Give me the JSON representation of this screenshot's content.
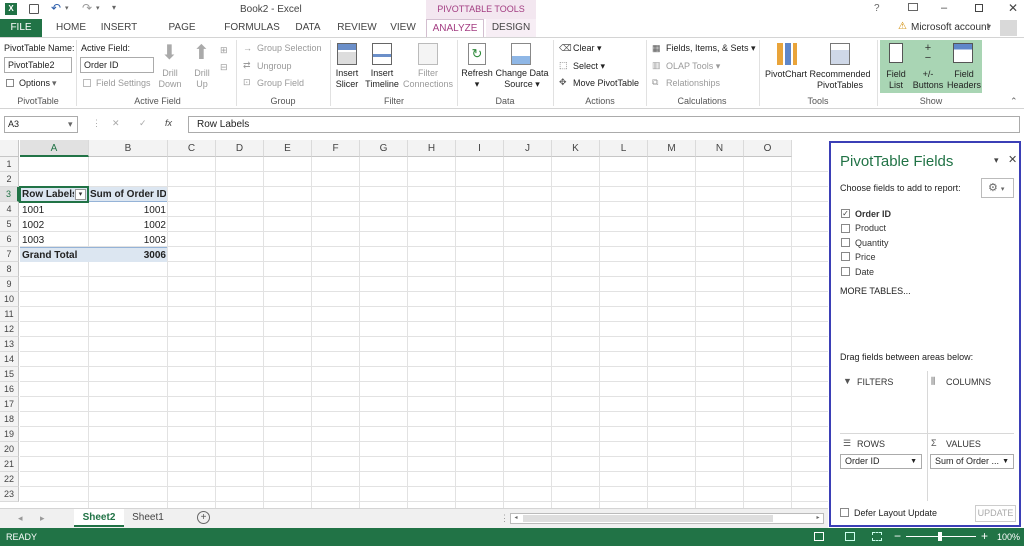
{
  "window": {
    "title": "Book2 - Excel",
    "context_group": "PIVOTTABLE TOOLS",
    "account": "Microsoft account"
  },
  "tabs": {
    "file": "FILE",
    "home": "HOME",
    "insert": "INSERT",
    "page_layout": "PAGE LAYOUT",
    "formulas": "FORMULAS",
    "data": "DATA",
    "review": "REVIEW",
    "view": "VIEW",
    "analyze": "ANALYZE",
    "design": "DESIGN"
  },
  "ribbon": {
    "pivottable": {
      "name_label": "PivotTable Name:",
      "name_value": "PivotTable2",
      "options": "Options",
      "group": "PivotTable"
    },
    "active_field": {
      "label": "Active Field:",
      "value": "Order ID",
      "field_settings": "Field Settings",
      "drill_down_1": "Drill",
      "drill_down_2": "Down",
      "drill_up_1": "Drill",
      "drill_up_2": "Up",
      "group": "Active Field"
    },
    "group_grp": {
      "group_selection": "Group Selection",
      "ungroup": "Ungroup",
      "group_field": "Group Field",
      "group": "Group"
    },
    "filter": {
      "insert_slicer_1": "Insert",
      "insert_slicer_2": "Slicer",
      "insert_timeline_1": "Insert",
      "insert_timeline_2": "Timeline",
      "filter_conn_1": "Filter",
      "filter_conn_2": "Connections",
      "group": "Filter"
    },
    "data": {
      "refresh": "Refresh",
      "change_source_1": "Change Data",
      "change_source_2": "Source",
      "group": "Data"
    },
    "actions": {
      "clear": "Clear",
      "select": "Select",
      "move": "Move PivotTable",
      "group": "Actions"
    },
    "calculations": {
      "fields_items": "Fields, Items, & Sets",
      "olap": "OLAP Tools",
      "relationships": "Relationships",
      "group": "Calculations"
    },
    "tools": {
      "pivotchart": "PivotChart",
      "recommended_1": "Recommended",
      "recommended_2": "PivotTables",
      "group": "Tools"
    },
    "show": {
      "field_list_1": "Field",
      "field_list_2": "List",
      "buttons_1": "+/-",
      "buttons_2": "Buttons",
      "headers_1": "Field",
      "headers_2": "Headers",
      "group": "Show"
    }
  },
  "formula_bar": {
    "name_box": "A3",
    "fx": "fx",
    "content": "Row Labels"
  },
  "grid": {
    "columns": [
      "A",
      "B",
      "C",
      "D",
      "E",
      "F",
      "G",
      "H",
      "I",
      "J",
      "K",
      "L",
      "M",
      "N",
      "O"
    ],
    "rows": [
      "1",
      "2",
      "3",
      "4",
      "5",
      "6",
      "7",
      "8",
      "9",
      "10",
      "11",
      "12",
      "13",
      "14",
      "15",
      "16",
      "17",
      "18",
      "19",
      "20",
      "21",
      "22",
      "23"
    ],
    "pivot": {
      "header": [
        "Row Labels",
        "Sum of Order ID"
      ],
      "body": [
        [
          "1001",
          "1001"
        ],
        [
          "1002",
          "1002"
        ],
        [
          "1003",
          "1003"
        ]
      ],
      "total": [
        "Grand Total",
        "3006"
      ]
    }
  },
  "panel": {
    "title": "PivotTable Fields",
    "choose": "Choose fields to add to report:",
    "fields": [
      {
        "name": "Order ID",
        "checked": true
      },
      {
        "name": "Product",
        "checked": false
      },
      {
        "name": "Quantity",
        "checked": false
      },
      {
        "name": "Price",
        "checked": false
      },
      {
        "name": "Date",
        "checked": false
      }
    ],
    "more_tables": "MORE TABLES...",
    "drag_hint": "Drag fields between areas below:",
    "filters": "FILTERS",
    "columns": "COLUMNS",
    "rows": "ROWS",
    "values": "VALUES",
    "rows_item": "Order ID",
    "values_item": "Sum of Order ...",
    "defer": "Defer Layout Update",
    "update": "UPDATE"
  },
  "sheets": {
    "active": "Sheet2",
    "other": "Sheet1"
  },
  "status": {
    "ready": "READY",
    "zoom": "100%"
  },
  "colors": {
    "excel_green": "#217346",
    "context_purple": "#a33d82",
    "panel_border": "#3b3fb6",
    "pivot_header": "#dce6f1"
  }
}
